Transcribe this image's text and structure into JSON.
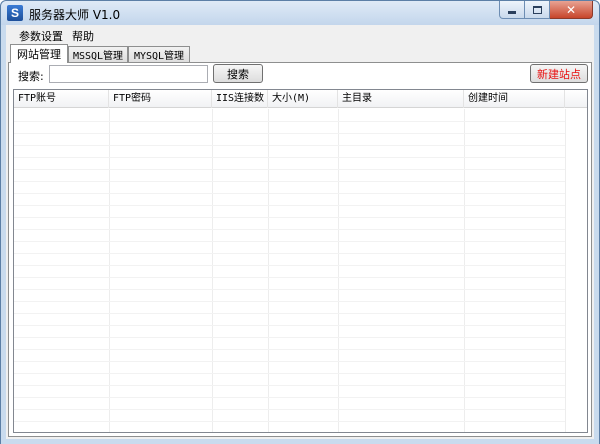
{
  "window": {
    "title": "服务器大师 V1.0",
    "icon_glyph": "S",
    "close_glyph": "✕"
  },
  "menu": {
    "items": [
      {
        "label": "参数设置"
      },
      {
        "label": "帮助"
      }
    ]
  },
  "tabs": [
    {
      "label": "网站管理",
      "active": true
    },
    {
      "label": "MSSQL管理",
      "active": false
    },
    {
      "label": "MYSQL管理",
      "active": false
    }
  ],
  "search": {
    "label": "搜索:",
    "value": "",
    "placeholder": "",
    "button_label": "搜索"
  },
  "new_site_button": {
    "label": "新建站点",
    "color": "#e81010"
  },
  "table": {
    "columns": [
      "FTP账号",
      "FTP密码",
      "IIS连接数",
      "大小(M)",
      "主目录",
      "创建时间",
      ""
    ],
    "rows": []
  },
  "colors": {
    "titlebar": "#c9dbee",
    "client": "#f0f0f0",
    "accent_red": "#e81010"
  }
}
